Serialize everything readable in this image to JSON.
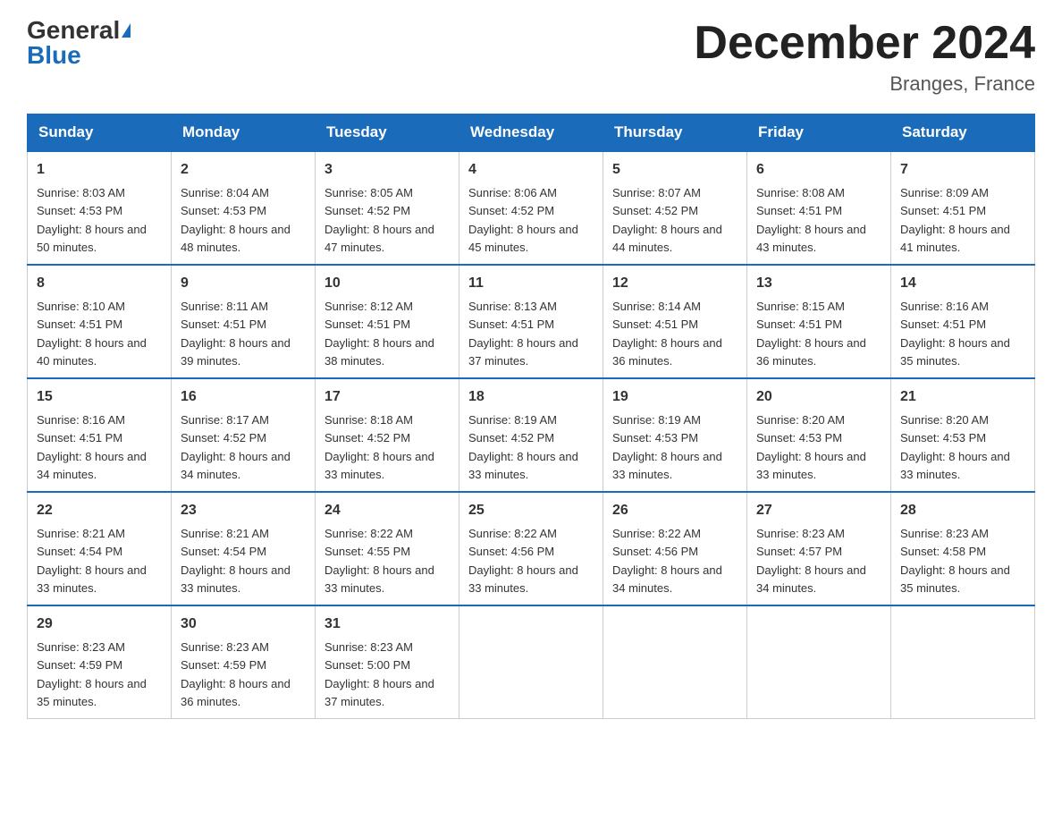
{
  "header": {
    "logo_general": "General",
    "logo_blue": "Blue",
    "month_title": "December 2024",
    "location": "Branges, France"
  },
  "days_of_week": [
    "Sunday",
    "Monday",
    "Tuesday",
    "Wednesday",
    "Thursday",
    "Friday",
    "Saturday"
  ],
  "weeks": [
    [
      {
        "day": "1",
        "sunrise": "8:03 AM",
        "sunset": "4:53 PM",
        "daylight": "8 hours and 50 minutes."
      },
      {
        "day": "2",
        "sunrise": "8:04 AM",
        "sunset": "4:53 PM",
        "daylight": "8 hours and 48 minutes."
      },
      {
        "day": "3",
        "sunrise": "8:05 AM",
        "sunset": "4:52 PM",
        "daylight": "8 hours and 47 minutes."
      },
      {
        "day": "4",
        "sunrise": "8:06 AM",
        "sunset": "4:52 PM",
        "daylight": "8 hours and 45 minutes."
      },
      {
        "day": "5",
        "sunrise": "8:07 AM",
        "sunset": "4:52 PM",
        "daylight": "8 hours and 44 minutes."
      },
      {
        "day": "6",
        "sunrise": "8:08 AM",
        "sunset": "4:51 PM",
        "daylight": "8 hours and 43 minutes."
      },
      {
        "day": "7",
        "sunrise": "8:09 AM",
        "sunset": "4:51 PM",
        "daylight": "8 hours and 41 minutes."
      }
    ],
    [
      {
        "day": "8",
        "sunrise": "8:10 AM",
        "sunset": "4:51 PM",
        "daylight": "8 hours and 40 minutes."
      },
      {
        "day": "9",
        "sunrise": "8:11 AM",
        "sunset": "4:51 PM",
        "daylight": "8 hours and 39 minutes."
      },
      {
        "day": "10",
        "sunrise": "8:12 AM",
        "sunset": "4:51 PM",
        "daylight": "8 hours and 38 minutes."
      },
      {
        "day": "11",
        "sunrise": "8:13 AM",
        "sunset": "4:51 PM",
        "daylight": "8 hours and 37 minutes."
      },
      {
        "day": "12",
        "sunrise": "8:14 AM",
        "sunset": "4:51 PM",
        "daylight": "8 hours and 36 minutes."
      },
      {
        "day": "13",
        "sunrise": "8:15 AM",
        "sunset": "4:51 PM",
        "daylight": "8 hours and 36 minutes."
      },
      {
        "day": "14",
        "sunrise": "8:16 AM",
        "sunset": "4:51 PM",
        "daylight": "8 hours and 35 minutes."
      }
    ],
    [
      {
        "day": "15",
        "sunrise": "8:16 AM",
        "sunset": "4:51 PM",
        "daylight": "8 hours and 34 minutes."
      },
      {
        "day": "16",
        "sunrise": "8:17 AM",
        "sunset": "4:52 PM",
        "daylight": "8 hours and 34 minutes."
      },
      {
        "day": "17",
        "sunrise": "8:18 AM",
        "sunset": "4:52 PM",
        "daylight": "8 hours and 33 minutes."
      },
      {
        "day": "18",
        "sunrise": "8:19 AM",
        "sunset": "4:52 PM",
        "daylight": "8 hours and 33 minutes."
      },
      {
        "day": "19",
        "sunrise": "8:19 AM",
        "sunset": "4:53 PM",
        "daylight": "8 hours and 33 minutes."
      },
      {
        "day": "20",
        "sunrise": "8:20 AM",
        "sunset": "4:53 PM",
        "daylight": "8 hours and 33 minutes."
      },
      {
        "day": "21",
        "sunrise": "8:20 AM",
        "sunset": "4:53 PM",
        "daylight": "8 hours and 33 minutes."
      }
    ],
    [
      {
        "day": "22",
        "sunrise": "8:21 AM",
        "sunset": "4:54 PM",
        "daylight": "8 hours and 33 minutes."
      },
      {
        "day": "23",
        "sunrise": "8:21 AM",
        "sunset": "4:54 PM",
        "daylight": "8 hours and 33 minutes."
      },
      {
        "day": "24",
        "sunrise": "8:22 AM",
        "sunset": "4:55 PM",
        "daylight": "8 hours and 33 minutes."
      },
      {
        "day": "25",
        "sunrise": "8:22 AM",
        "sunset": "4:56 PM",
        "daylight": "8 hours and 33 minutes."
      },
      {
        "day": "26",
        "sunrise": "8:22 AM",
        "sunset": "4:56 PM",
        "daylight": "8 hours and 34 minutes."
      },
      {
        "day": "27",
        "sunrise": "8:23 AM",
        "sunset": "4:57 PM",
        "daylight": "8 hours and 34 minutes."
      },
      {
        "day": "28",
        "sunrise": "8:23 AM",
        "sunset": "4:58 PM",
        "daylight": "8 hours and 35 minutes."
      }
    ],
    [
      {
        "day": "29",
        "sunrise": "8:23 AM",
        "sunset": "4:59 PM",
        "daylight": "8 hours and 35 minutes."
      },
      {
        "day": "30",
        "sunrise": "8:23 AM",
        "sunset": "4:59 PM",
        "daylight": "8 hours and 36 minutes."
      },
      {
        "day": "31",
        "sunrise": "8:23 AM",
        "sunset": "5:00 PM",
        "daylight": "8 hours and 37 minutes."
      },
      null,
      null,
      null,
      null
    ]
  ],
  "labels": {
    "sunrise": "Sunrise: ",
    "sunset": "Sunset: ",
    "daylight": "Daylight: "
  }
}
